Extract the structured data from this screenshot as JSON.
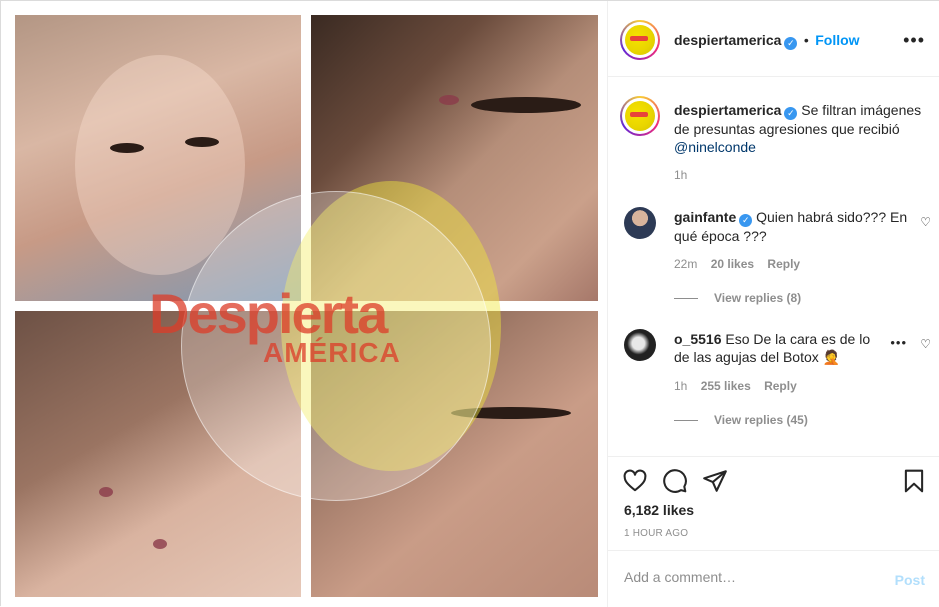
{
  "header": {
    "username": "despiertamerica",
    "separator": "•",
    "follow_label": "Follow"
  },
  "media": {
    "watermark_line1": "Despierta",
    "watermark_line2": "AMÉRICA"
  },
  "caption": {
    "username": "despiertamerica",
    "text": "Se filtran imágenes de presuntas agresiones que recibió",
    "mention": "@ninelconde",
    "time": "1h"
  },
  "comments": [
    {
      "username": "gainfante",
      "verified": true,
      "text": "Quien habrá sido??? En qué época ???",
      "time": "22m",
      "likes": "20 likes",
      "reply_label": "Reply",
      "view_replies": "View replies (8)"
    },
    {
      "username": "o_5516",
      "verified": false,
      "text": "Eso De la cara es de lo de las agujas del Botox 🤦",
      "time": "1h",
      "likes": "255 likes",
      "reply_label": "Reply",
      "view_replies": "View replies (45)"
    }
  ],
  "actions": {
    "likes": "6,182 likes",
    "timestamp": "1 HOUR AGO"
  },
  "add_comment": {
    "placeholder": "Add a comment…",
    "post_label": "Post"
  },
  "colors": {
    "accent": "#0095f6",
    "verified": "#3897f0",
    "post_disabled": "#b2dffc"
  }
}
